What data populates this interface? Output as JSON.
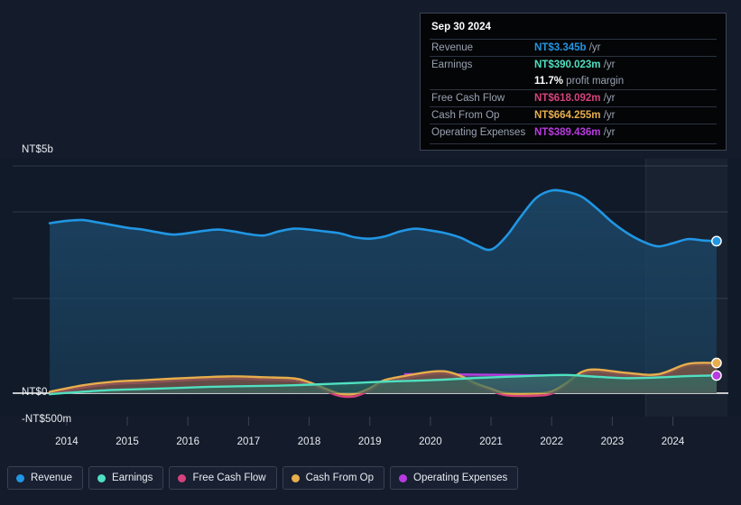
{
  "tooltip": {
    "date": "Sep 30 2024",
    "rows": [
      {
        "label": "Revenue",
        "value": "NT$3.345b",
        "unit": "/yr",
        "color": "#2196e3"
      },
      {
        "label": "Earnings",
        "value": "NT$390.023m",
        "unit": "/yr",
        "color": "#4fe0c0"
      },
      {
        "label": "",
        "value": "11.7%",
        "unit": "profit margin",
        "color": "#ffffff"
      },
      {
        "label": "Free Cash Flow",
        "value": "NT$618.092m",
        "unit": "/yr",
        "color": "#d6427d"
      },
      {
        "label": "Cash From Op",
        "value": "NT$664.255m",
        "unit": "/yr",
        "color": "#e8ae4c"
      },
      {
        "label": "Operating Expenses",
        "value": "NT$389.436m",
        "unit": "/yr",
        "color": "#b83be0"
      }
    ]
  },
  "legend": [
    {
      "label": "Revenue",
      "color": "#2196e3"
    },
    {
      "label": "Earnings",
      "color": "#4fe0c0"
    },
    {
      "label": "Free Cash Flow",
      "color": "#d6427d"
    },
    {
      "label": "Cash From Op",
      "color": "#e8ae4c"
    },
    {
      "label": "Operating Expenses",
      "color": "#b83be0"
    }
  ],
  "chart_data": {
    "type": "area",
    "title": "",
    "xlabel": "",
    "ylabel": "",
    "currency": "NT$",
    "y_ticks": [
      {
        "label": "NT$5b",
        "value": 5000
      },
      {
        "label": "NT$0",
        "value": 0
      },
      {
        "label": "-NT$500m",
        "value": -500
      }
    ],
    "ylim": [
      -500,
      5600
    ],
    "xlim": [
      2013.6,
      2024.9
    ],
    "grid": true,
    "legend_position": "bottom-left",
    "x_tick_labels": [
      "2014",
      "2015",
      "2016",
      "2017",
      "2018",
      "2019",
      "2020",
      "2021",
      "2022",
      "2023",
      "2024"
    ],
    "x_tick_values": [
      2014,
      2015,
      2016,
      2017,
      2018,
      2019,
      2020,
      2021,
      2022,
      2023,
      2024
    ],
    "forecast_start": 2023.55,
    "series": [
      {
        "name": "Revenue",
        "color": "#2196e3",
        "fill": "#1b4463",
        "x": [
          2013.72,
          2014.0,
          2014.25,
          2014.5,
          2014.75,
          2015.0,
          2015.25,
          2015.5,
          2015.75,
          2016.0,
          2016.25,
          2016.5,
          2016.75,
          2017.0,
          2017.25,
          2017.5,
          2017.75,
          2018.0,
          2018.25,
          2018.5,
          2018.75,
          2019.0,
          2019.25,
          2019.5,
          2019.75,
          2020.0,
          2020.25,
          2020.5,
          2020.75,
          2021.0,
          2021.25,
          2021.5,
          2021.75,
          2022.0,
          2022.25,
          2022.5,
          2022.75,
          2023.0,
          2023.25,
          2023.5,
          2023.75,
          2024.0,
          2024.25,
          2024.5,
          2024.72
        ],
        "y": [
          3740,
          3790,
          3810,
          3760,
          3700,
          3640,
          3600,
          3540,
          3490,
          3520,
          3570,
          3600,
          3560,
          3500,
          3470,
          3560,
          3620,
          3600,
          3560,
          3520,
          3430,
          3400,
          3450,
          3560,
          3620,
          3580,
          3520,
          3420,
          3260,
          3160,
          3450,
          3900,
          4300,
          4460,
          4430,
          4320,
          4060,
          3760,
          3520,
          3340,
          3230,
          3300,
          3390,
          3360,
          3345
        ]
      },
      {
        "name": "Earnings",
        "color": "#4fe0c0",
        "fill": "#2e6a60",
        "x": [
          2013.72,
          2014.25,
          2014.75,
          2015.25,
          2015.75,
          2016.25,
          2016.75,
          2017.25,
          2017.75,
          2018.25,
          2018.75,
          2019.25,
          2019.75,
          2020.25,
          2020.75,
          2021.25,
          2021.75,
          2022.25,
          2022.75,
          2023.25,
          2023.75,
          2024.25,
          2024.72
        ],
        "y": [
          -20,
          30,
          70,
          90,
          110,
          135,
          150,
          160,
          175,
          200,
          225,
          255,
          275,
          300,
          335,
          360,
          385,
          400,
          360,
          330,
          345,
          375,
          390
        ]
      },
      {
        "name": "Free Cash Flow",
        "color": "#d6427d",
        "fill": "#7a3050",
        "x": [
          2013.72,
          2014.25,
          2014.75,
          2015.25,
          2015.75,
          2016.25,
          2016.75,
          2017.25,
          2017.75,
          2018.0,
          2018.25,
          2018.5,
          2018.75,
          2019.0,
          2019.25,
          2019.75,
          2020.0,
          2020.25,
          2020.5,
          2020.75,
          2021.0,
          2021.25,
          2021.75,
          2022.0,
          2022.25,
          2022.5,
          2022.75,
          2023.25,
          2023.75,
          2024.25,
          2024.72
        ],
        "y": [
          -20,
          120,
          200,
          230,
          270,
          300,
          320,
          300,
          275,
          190,
          60,
          -60,
          -70,
          60,
          230,
          370,
          420,
          430,
          330,
          170,
          55,
          -45,
          -55,
          -10,
          180,
          420,
          470,
          400,
          370,
          600,
          618
        ]
      },
      {
        "name": "Cash From Op",
        "color": "#e8ae4c",
        "fill": "#6b5a42",
        "x": [
          2013.72,
          2014.25,
          2014.75,
          2015.25,
          2015.75,
          2016.25,
          2016.75,
          2017.25,
          2017.75,
          2018.0,
          2018.25,
          2018.5,
          2018.75,
          2019.0,
          2019.25,
          2019.75,
          2020.0,
          2020.25,
          2020.5,
          2020.75,
          2021.0,
          2021.25,
          2021.75,
          2022.0,
          2022.25,
          2022.5,
          2022.75,
          2023.25,
          2023.75,
          2024.25,
          2024.72
        ],
        "y": [
          30,
          170,
          250,
          285,
          320,
          350,
          370,
          350,
          325,
          240,
          110,
          -10,
          -15,
          110,
          290,
          420,
          470,
          480,
          380,
          215,
          100,
          0,
          -5,
          40,
          230,
          470,
          520,
          445,
          415,
          645,
          664
        ]
      },
      {
        "name": "Operating Expenses",
        "color": "#b83be0",
        "fill": "#5d4a86",
        "x": [
          2019.58,
          2019.9,
          2020.3,
          2020.8,
          2021.3,
          2021.8,
          2022.3,
          2022.8,
          2023.3,
          2023.8,
          2024.3,
          2024.72
        ],
        "y": [
          418,
          420,
          415,
          408,
          400,
          392,
          388,
          385,
          385,
          386,
          388,
          389
        ]
      }
    ]
  }
}
